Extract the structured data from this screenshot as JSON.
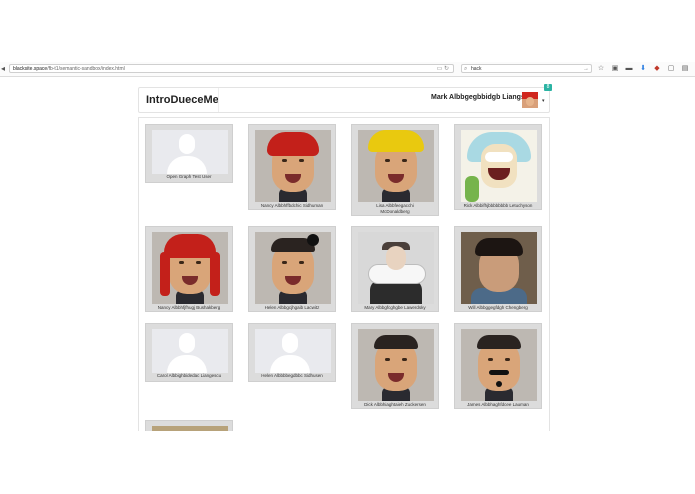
{
  "browser": {
    "url_host": "blacksite.space",
    "url_path": "/fb-t1/semantic-sandbox/index.html",
    "search_text": "hack"
  },
  "app": {
    "brand": "IntroDueceMe",
    "user_name": "Mark Albbgegbbidgb Liangsky",
    "notification_count": "8"
  },
  "people": [
    {
      "name": "Open Graph Test User",
      "photo": "placeholder"
    },
    {
      "name": "Nancy Albbhffbdchic Sidhuman",
      "photo": "red-wig"
    },
    {
      "name": "Lisa Albbfeegacchi McDonaldberg",
      "photo": "yellow-wig"
    },
    {
      "name": "Rick Albbifhjbbbbbbbb Letuchyson",
      "photo": "cartoon"
    },
    {
      "name": "Nancy Albbhfjfhugj Bushakberg",
      "photo": "red-braids"
    },
    {
      "name": "Helen Albbgcjhgaib Lacwitz",
      "photo": "bun"
    },
    {
      "name": "Mary Albbgfcghgbe Lawerdsky",
      "photo": "portrait"
    },
    {
      "name": "Will Albbggegfdgh Chengberg",
      "photo": "man"
    },
    {
      "name": "Carol Albbighbidedac Liangescu",
      "photo": "placeholder"
    },
    {
      "name": "Helen Albbbbegdbbc Sidhusen",
      "photo": "placeholder"
    },
    {
      "name": "Dick Albbhiaghtaieh Zuckersen",
      "photo": "face"
    },
    {
      "name": "James Albbhaghfdcee Lauman",
      "photo": "mustache"
    }
  ]
}
